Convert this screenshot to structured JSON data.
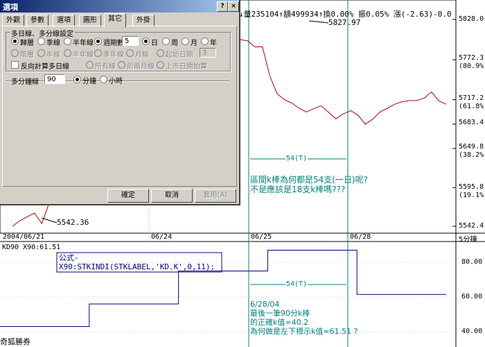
{
  "dialog": {
    "title": "選項",
    "close_glyph": "×",
    "help_glyph": "?",
    "tabs": [
      "外觀",
      "參數",
      "選項",
      "圖形",
      "其它",
      "外掛"
    ],
    "active_tab": 4,
    "group_title": "多日線、多分線設定",
    "row1": {
      "opt_daily": "歸層",
      "opt_quarter": "季線",
      "opt_half": "半年線",
      "opt_custom": "週期數",
      "period_value": "5",
      "unit_day": "日",
      "unit_week": "周",
      "unit_month": "月",
      "unit_year": "年"
    },
    "row2": {
      "opt_a": "階層",
      "opt_b": "半線",
      "opt_c": "半年線",
      "opt_d": "季年線",
      "opt_e": "月線",
      "opt_f": "起始日期",
      "start_value": "3"
    },
    "row3": {
      "reverse_label": "反向計算多日線",
      "opt_g": "所有線",
      "opt_h": "前兩月線",
      "opt_i": "上市日開始算"
    },
    "minutes": {
      "label": "多分鐘線",
      "value": "90",
      "unit_minute": "分鐘",
      "unit_hour": "小時"
    },
    "buttons": {
      "ok": "確定",
      "cancel": "取消",
      "apply": "套用(A)"
    }
  },
  "price_header": "↓量235104↑額499934↑換0.00% 振0.05% 漲(-2.63)-0.0",
  "price_axis": [
    {
      "value": "5828.0",
      "pct": ""
    },
    {
      "value": "5772.3",
      "pct": "(80.9%)"
    },
    {
      "value": "5717.2",
      "pct": "(61.8%)"
    },
    {
      "value": "5683.4",
      "pct": ""
    },
    {
      "value": "5649.8",
      "pct": "(38.2%)"
    },
    {
      "value": "5595.8",
      "pct": "(19.1%)"
    },
    {
      "value": "5542.4",
      "pct": ""
    }
  ],
  "peak_label": "5827.97",
  "low_label": "5542.36",
  "dates": [
    "2004/06/21",
    "06/24",
    "06/25",
    "06/28"
  ],
  "interval_label": "5分鐘",
  "range_label": "54(T)",
  "question1": [
    "區間k棒為何都是54支(一日)呢?",
    "不是應該是18支k棒嗎???"
  ],
  "kd_header": "KD90 X90:61.51",
  "formula": [
    "公式-",
    "X90:STKINDI(STKLABEL,'KD.K',0,11);"
  ],
  "kd_axis": [
    "80.00",
    "60.00",
    "40.00"
  ],
  "note2": [
    "6/28/04",
    "最後一筆90分k棒",
    "的正確k值=40.2",
    "為何做是左下標示k值=61.51 ?"
  ],
  "watermark": "奇狐勝券",
  "colors": {
    "price_line": "#b00000",
    "kd_line": "#000080",
    "cyan_marker": "#008080",
    "annotation": "#007f7f",
    "dialog_face": "#d4d0c8",
    "titlebar": "#0a246a"
  },
  "chart_data": {
    "type": "line",
    "series": [
      {
        "values": [
          5542.4,
          5550.1,
          5555.4,
          5560.6,
          5546.0,
          5575.2,
          5585.5,
          5600.2,
          5612.6,
          5645.0,
          5680.5,
          5700.2,
          5725.3,
          5740.0,
          5752.7,
          5760.3,
          5770.8,
          5780.2,
          5772.3,
          5775.4,
          5790.4,
          5790.0,
          5800.0,
          5806.5,
          5813.6,
          5816.9,
          5814.1,
          5817.2,
          5827.97,
          5813.8,
          5805.2,
          5800.1,
          5798.4,
          5790.0,
          5790.2,
          5750.0,
          5725.3,
          5717.2,
          5712.6,
          5705.3,
          5700.2,
          5704.9,
          5708.8,
          5699.9,
          5690.8,
          5697.6,
          5702.1,
          5695.8,
          5683.4,
          5690.3,
          5700.2,
          5705.3,
          5710.9,
          5714.3,
          5716.0,
          5716.0,
          5719.4,
          5727.9,
          5715.4,
          5710.9
        ]
      },
      {
        "values": [
          43,
          43,
          43,
          43,
          43,
          43,
          43,
          56,
          56,
          56,
          56,
          56,
          56,
          56,
          75,
          75,
          75,
          75,
          75,
          75,
          75,
          87,
          87,
          87,
          87,
          87,
          87,
          87,
          61.51,
          61.51,
          61.51,
          61.51,
          61.51,
          61.51,
          61.51
        ]
      }
    ],
    "ylim": [
      5542.4,
      5828.0
    ],
    "kd_ylim": [
      40,
      80
    ],
    "grid": false
  }
}
